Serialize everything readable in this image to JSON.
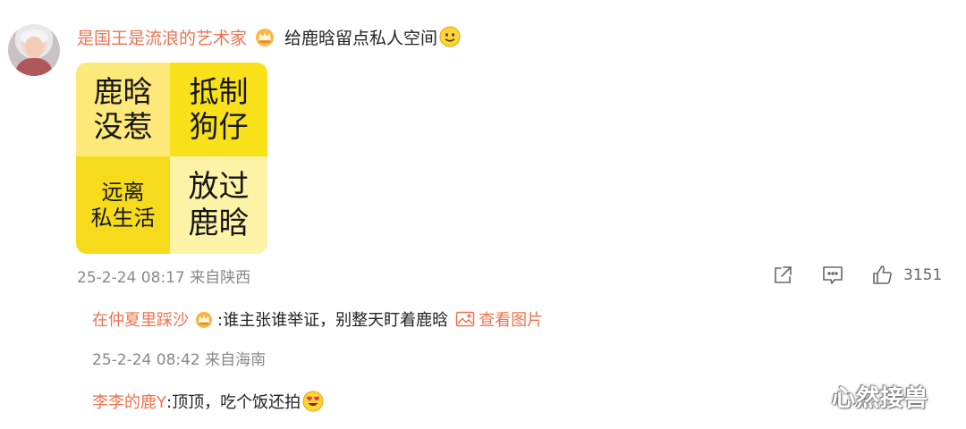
{
  "post": {
    "author": "是国王是流浪的艺术家",
    "badge_icon": "crown-badge-icon",
    "text": "给鹿晗留点私人空间",
    "text_emoji": "smile-emoji-icon",
    "image_grid": [
      {
        "line1": "鹿晗",
        "line2": "没惹"
      },
      {
        "line1": "抵制",
        "line2": "狗仔"
      },
      {
        "line1": "远离",
        "line2": "私生活"
      },
      {
        "line1": "放过",
        "line2": "鹿晗"
      }
    ],
    "timestamp": "25-2-24 08:17",
    "location": "来自陕西",
    "like_count": "3151",
    "accent_color": "#eb7350",
    "grid_colors": [
      "#fde87a",
      "#f9e11a",
      "#f6db1c",
      "#fdf3a6"
    ]
  },
  "comments": [
    {
      "user": "在仲夏里踩沙",
      "badge_icon": "crown-badge-icon",
      "text": ":谁主张谁举证，别整天盯着鹿晗",
      "view_image_label": "查看图片",
      "timestamp": "25-2-24 08:42",
      "location": "来自海南"
    },
    {
      "user": "李李的鹿Y",
      "text": ":顶顶，吃个饭还拍",
      "emoji": "heart-eyes-emoji-icon"
    }
  ],
  "watermark": "心然接兽"
}
